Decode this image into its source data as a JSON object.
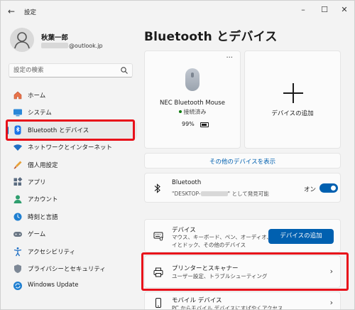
{
  "app": {
    "title": "設定"
  },
  "user": {
    "name": "秋葉一郎",
    "email_suffix": "@outlook.jp"
  },
  "search": {
    "placeholder": "設定の検索"
  },
  "sidebar": {
    "items": [
      {
        "label": "ホーム",
        "icon": "home-icon"
      },
      {
        "label": "システム",
        "icon": "system-icon"
      },
      {
        "label": "Bluetooth とデバイス",
        "icon": "bluetooth-icon",
        "active": true
      },
      {
        "label": "ネットワークとインターネット",
        "icon": "network-icon"
      },
      {
        "label": "個人用設定",
        "icon": "personalization-icon"
      },
      {
        "label": "アプリ",
        "icon": "apps-icon"
      },
      {
        "label": "アカウント",
        "icon": "account-icon"
      },
      {
        "label": "時刻と言語",
        "icon": "time-language-icon"
      },
      {
        "label": "ゲーム",
        "icon": "gaming-icon"
      },
      {
        "label": "アクセシビリティ",
        "icon": "accessibility-icon"
      },
      {
        "label": "プライバシーとセキュリティ",
        "icon": "privacy-icon"
      },
      {
        "label": "Windows Update",
        "icon": "windows-update-icon"
      }
    ]
  },
  "main": {
    "title": "Bluetooth とデバイス",
    "device": {
      "more": "···",
      "name": "NEC Bluetooth Mouse",
      "status": "接続済み",
      "battery": "99%"
    },
    "add_device_label": "デバイスの追加",
    "more_devices_link": "その他のデバイスを表示",
    "bluetooth": {
      "title": "Bluetooth",
      "subtitle_prefix": "\"DESKTOP-",
      "subtitle_suffix": "\" として発見可能",
      "toggle_label": "オン",
      "toggle_on": true
    },
    "devices_row": {
      "title": "デバイス",
      "subtitle_line1": "マウス、キーボード、ペン、オーディオ、ディスプレ",
      "subtitle_line2": "イとドック、その他のデバイス",
      "button": "デバイスの追加"
    },
    "printers_row": {
      "title": "プリンターとスキャナー",
      "subtitle": "ユーザー設定、トラブルシューティング"
    },
    "mobile_row": {
      "title": "モバイル デバイス",
      "subtitle": "PC からモバイル デバイスにすばやくアクセス"
    }
  },
  "colors": {
    "accent": "#0060b0",
    "highlight": "#e8101a",
    "connected": "#0f7b0f"
  }
}
